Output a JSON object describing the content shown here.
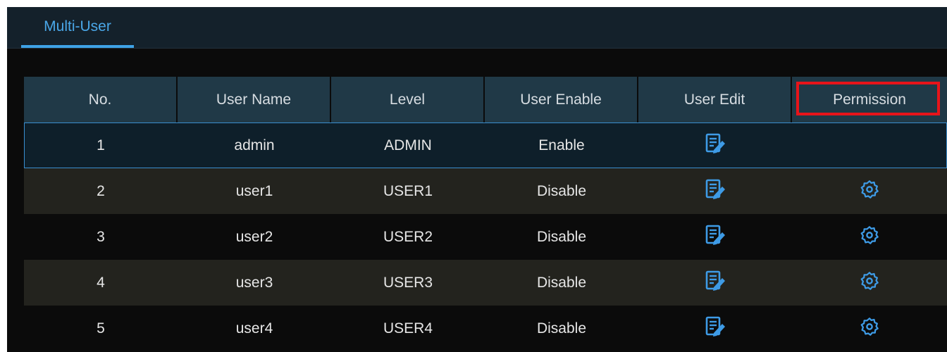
{
  "tabs": [
    {
      "label": "Multi-User",
      "active": true
    }
  ],
  "table": {
    "headers": [
      "No.",
      "User Name",
      "Level",
      "User Enable",
      "User Edit",
      "Permission"
    ],
    "rows": [
      {
        "no": "1",
        "name": "admin",
        "level": "ADMIN",
        "enable": "Enable",
        "edit_icon": "edit-icon",
        "permission_icon": null
      },
      {
        "no": "2",
        "name": "user1",
        "level": "USER1",
        "enable": "Disable",
        "edit_icon": "edit-icon",
        "permission_icon": "gear-icon"
      },
      {
        "no": "3",
        "name": "user2",
        "level": "USER2",
        "enable": "Disable",
        "edit_icon": "edit-icon",
        "permission_icon": "gear-icon"
      },
      {
        "no": "4",
        "name": "user3",
        "level": "USER3",
        "enable": "Disable",
        "edit_icon": "edit-icon",
        "permission_icon": "gear-icon"
      },
      {
        "no": "5",
        "name": "user4",
        "level": "USER4",
        "enable": "Disable",
        "edit_icon": "edit-icon",
        "permission_icon": "gear-icon"
      }
    ],
    "selected_row": 0,
    "highlighted_header": "Permission"
  },
  "colors": {
    "accent": "#3ea2e6",
    "highlight_box": "#e8141a",
    "header_bg": "#203947",
    "row_alt_bg": "#23231e"
  }
}
